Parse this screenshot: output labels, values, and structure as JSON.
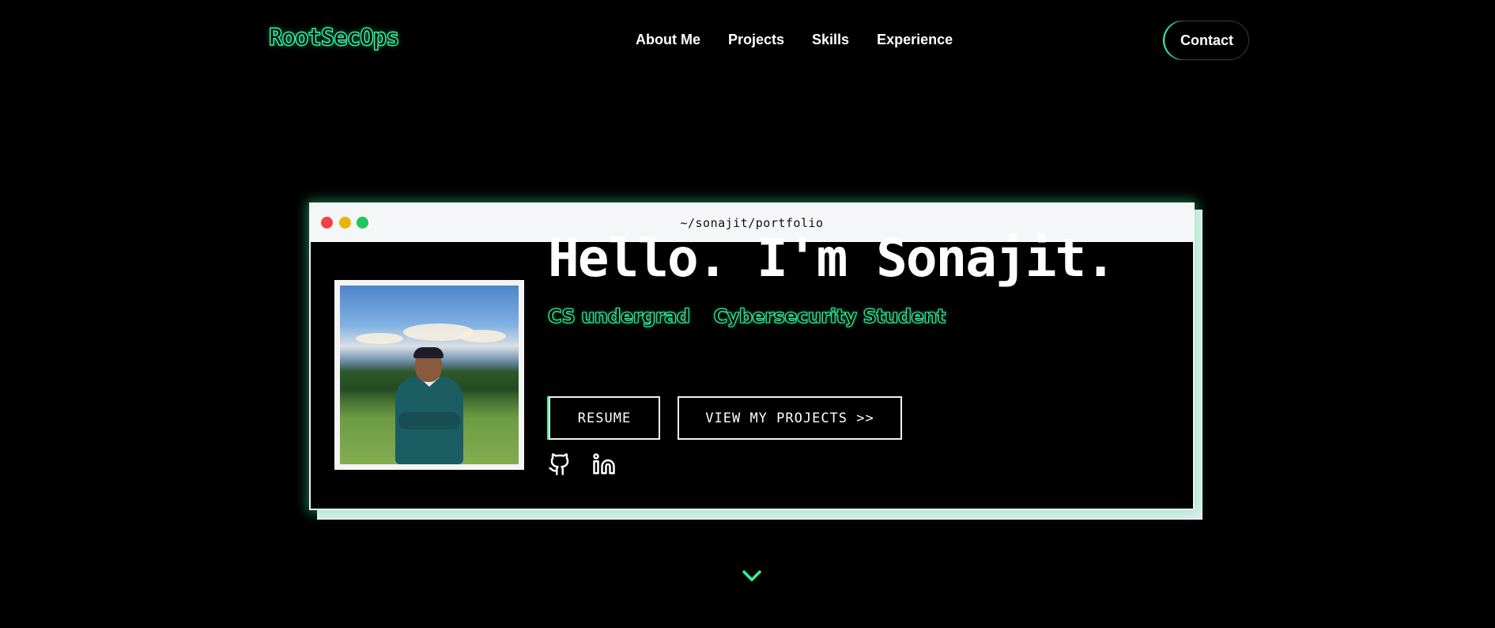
{
  "nav": {
    "logo": "RootSecOps",
    "links": [
      "About Me",
      "Projects",
      "Skills",
      "Experience"
    ],
    "contact_label": "Contact"
  },
  "terminal": {
    "path": "~/sonajit/portfolio",
    "window_buttons": [
      "close",
      "minimize",
      "maximize"
    ]
  },
  "hero": {
    "greeting": "Hello. I'm Sonajit.",
    "tags": [
      "CS undergrad",
      "Cybersecurity Student"
    ],
    "resume_label": "RESUME",
    "projects_label": "VIEW MY PROJECTS >>",
    "social_icons": [
      "github-icon",
      "linkedin-icon"
    ]
  },
  "colors": {
    "accent": "#2ef5a0",
    "background": "#000000",
    "titlebar": "#f5f6f8",
    "dot_red": "#ef4444",
    "dot_yellow": "#eab308",
    "dot_green": "#22c55e"
  }
}
